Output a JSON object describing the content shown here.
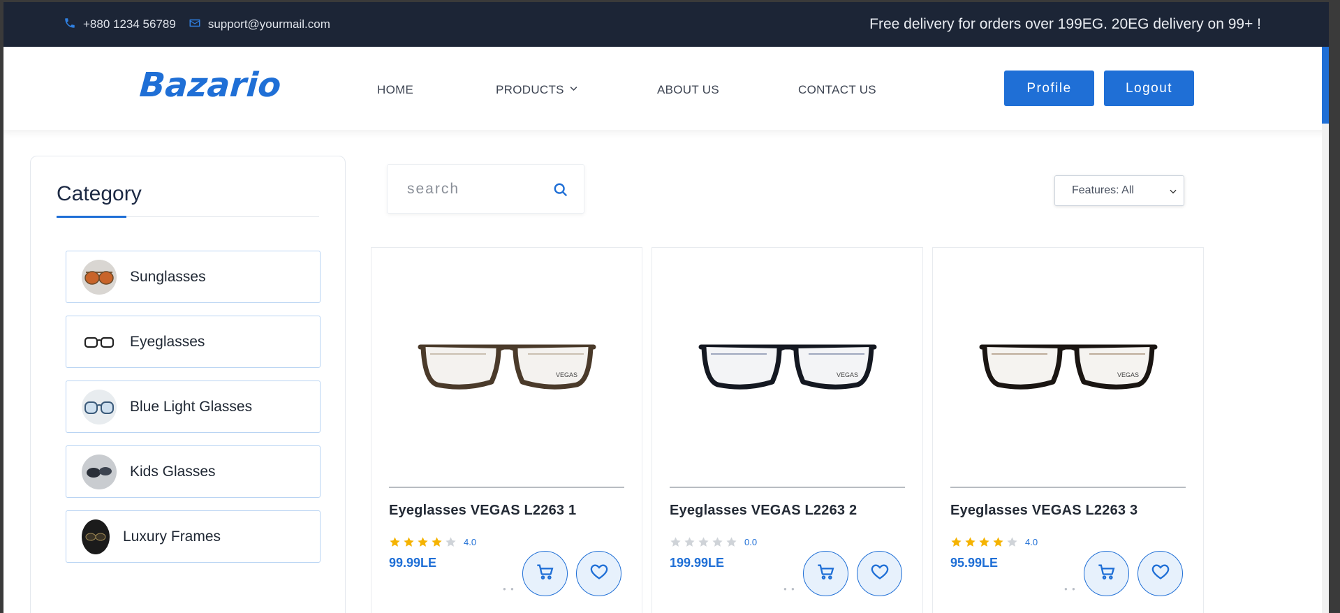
{
  "topbar": {
    "phone": "+880 1234 56789",
    "email": "support@yourmail.com",
    "promo": "Free delivery for orders over 199EG. 20EG delivery on 99+ !"
  },
  "header": {
    "logo": "Bazario",
    "nav": {
      "home": "HOME",
      "products": "PRODUCTS",
      "about": "ABOUT US",
      "contact": "CONTACT US"
    },
    "profile_label": "Profile",
    "logout_label": "Logout"
  },
  "sidebar": {
    "title": "Category",
    "items": [
      {
        "label": "Sunglasses",
        "icon": "sunglasses-icon"
      },
      {
        "label": "Eyeglasses",
        "icon": "eyeglasses-icon"
      },
      {
        "label": "Blue Light Glasses",
        "icon": "blue-light-glasses-icon"
      },
      {
        "label": "Kids Glasses",
        "icon": "kids-glasses-icon"
      },
      {
        "label": "Luxury Frames",
        "icon": "luxury-frames-icon"
      }
    ]
  },
  "search": {
    "placeholder": "search",
    "icon": "search-icon"
  },
  "filter": {
    "selected": "Features: All"
  },
  "colors": {
    "accent": "#1f6fd6",
    "topbar": "#1c2536",
    "star": "#f5b301",
    "star_empty": "#cfd3d8"
  },
  "products": [
    {
      "title": "Eyeglasses VEGAS L2263 1",
      "rating": 4,
      "rating_text": "4.0",
      "price": "99.99LE",
      "frame": "tortoise"
    },
    {
      "title": "Eyeglasses VEGAS L2263 2",
      "rating": 0,
      "rating_text": "0.0",
      "price": "199.99LE",
      "frame": "black-blue"
    },
    {
      "title": "Eyeglasses VEGAS L2263 3",
      "rating": 4,
      "rating_text": "4.0",
      "price": "95.99LE",
      "frame": "black-brown"
    }
  ]
}
